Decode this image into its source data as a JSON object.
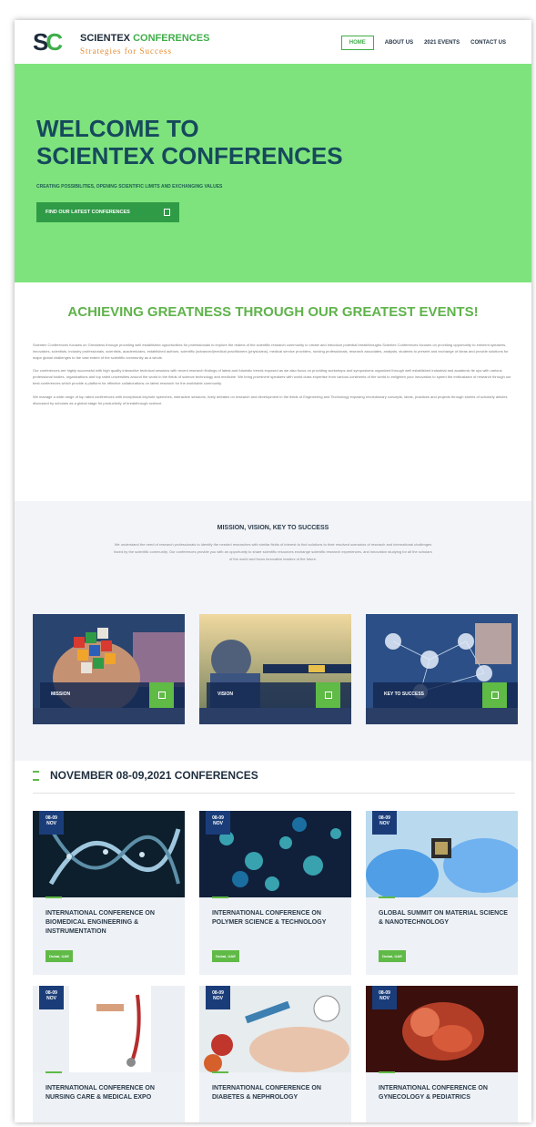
{
  "header": {
    "logo_mark": "SC",
    "logo_name_1": "SCIENTEX",
    "logo_name_2": "CONFERENCES",
    "logo_tagline": "Strategies for Success",
    "nav": [
      "HOME",
      "ABOUT US",
      "2021 EVENTS",
      "CONTACT US"
    ]
  },
  "hero": {
    "title_line1": "WELCOME TO",
    "title_line2": "SCIENTEX CONFERENCES",
    "subtitle": "CREATING POSSIBILITIES, OPENING SCIENTIFIC LIMITS AND EXCHANGING VALUES",
    "button_label": "FIND OUR LATEST CONFERENCES"
  },
  "achieving": {
    "title": "ACHIEVING GREATNESS THROUGH OUR GREATEST EVENTS!",
    "paragraphs": [
      "Scientex Conferences focuses on Greatness through providing well established opportunities for professionals to explore the realms of the scientific research community to create and introduce potential breakthroughs.Scientex Conferences focuses on providing opportunity to eminent speakers, innovators, scientists, industry professionals, scientists, academicians, established authors, scientific (advanced)medical practitioners (physicians), medical service providers, nursing professionals, research associates, analysts, students to present and exchange of ideas and provide solutions for major global challenges to the vast extent of the scientific community as a whole.",
      "Our conferences are highly successful with high quality interactive technical sessions with recent research findings of latest and futuristic trends exposed as we also focus on providing workshops and symposiums organized through well established industrial and academic tie ups with various professional bodies, organizations and top rated universities around the world in the fields of science technology and medicine. We bring prominent speakers with world class expertise from various continents of the world to enlighten your innovation to speed the enthusiasm of research through our best conferences which provide a platform for effective collaborations on latest research for the worldwide community.",
      "We manage a wide range of top rated conferences with exceptional keynote speeches, interactive sessions, lively debates on research and development in the fields of Engineering and Technology exposing revolutionary concepts, ideas, practices and projects through stories of scholarly articles discussed by scholars as a global stage for productivity of breakthrough science."
    ]
  },
  "mission": {
    "title": "MISSION, VISION, KEY TO SUCCESS",
    "text": "We understand the need of research professionals to identify the needed researches with similar fields of interest to find solutions to their resolved scenarios of research and international challenges faced by the scientific community. Our conferences provide you with an opportunity to share scientific resources exchange scientific research experiences, and innovation studying for all the scholars of the world and focus innovative leaders of the future.",
    "cards": [
      {
        "label": "MISSION"
      },
      {
        "label": "VISION"
      },
      {
        "label": "KEY TO SUCCESS"
      }
    ]
  },
  "conferences": {
    "heading": "NOVEMBER 08-09,2021 CONFERENCES",
    "items": [
      {
        "date_line1": "08-09",
        "date_line2": "NOV",
        "title": "INTERNATIONAL CONFERENCE ON BIOMEDICAL ENGINEERING & INSTRUMENTATION",
        "tag": "Dubai, UAE"
      },
      {
        "date_line1": "08-09",
        "date_line2": "NOV",
        "title": "INTERNATIONAL CONFERENCE ON POLYMER SCIENCE & TECHNOLOGY",
        "tag": "Dubai, UAE"
      },
      {
        "date_line1": "08-09",
        "date_line2": "NOV",
        "title": "GLOBAL SUMMIT ON MATERIAL SCIENCE & NANOTECHNOLOGY",
        "tag": "Dubai, UAE"
      },
      {
        "date_line1": "08-09",
        "date_line2": "NOV",
        "title": "INTERNATIONAL CONFERENCE ON NURSING CARE & MEDICAL EXPO",
        "tag": ""
      },
      {
        "date_line1": "08-09",
        "date_line2": "NOV",
        "title": "INTERNATIONAL CONFERENCE ON DIABETES & NEPHROLOGY",
        "tag": ""
      },
      {
        "date_line1": "08-09",
        "date_line2": "NOV",
        "title": "INTERNATIONAL CONFERENCE ON GYNECOLOGY & PEDIATRICS",
        "tag": ""
      }
    ]
  }
}
